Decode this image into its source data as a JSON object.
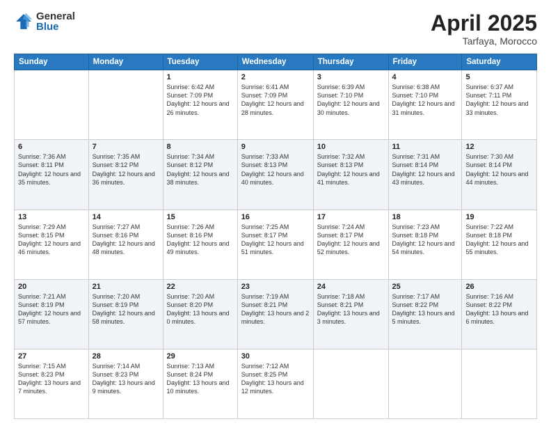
{
  "header": {
    "logo_general": "General",
    "logo_blue": "Blue",
    "title": "April 2025",
    "location": "Tarfaya, Morocco"
  },
  "days_of_week": [
    "Sunday",
    "Monday",
    "Tuesday",
    "Wednesday",
    "Thursday",
    "Friday",
    "Saturday"
  ],
  "weeks": [
    [
      {
        "day": "",
        "info": ""
      },
      {
        "day": "",
        "info": ""
      },
      {
        "day": "1",
        "info": "Sunrise: 6:42 AM\nSunset: 7:09 PM\nDaylight: 12 hours and 26 minutes."
      },
      {
        "day": "2",
        "info": "Sunrise: 6:41 AM\nSunset: 7:09 PM\nDaylight: 12 hours and 28 minutes."
      },
      {
        "day": "3",
        "info": "Sunrise: 6:39 AM\nSunset: 7:10 PM\nDaylight: 12 hours and 30 minutes."
      },
      {
        "day": "4",
        "info": "Sunrise: 6:38 AM\nSunset: 7:10 PM\nDaylight: 12 hours and 31 minutes."
      },
      {
        "day": "5",
        "info": "Sunrise: 6:37 AM\nSunset: 7:11 PM\nDaylight: 12 hours and 33 minutes."
      }
    ],
    [
      {
        "day": "6",
        "info": "Sunrise: 7:36 AM\nSunset: 8:11 PM\nDaylight: 12 hours and 35 minutes."
      },
      {
        "day": "7",
        "info": "Sunrise: 7:35 AM\nSunset: 8:12 PM\nDaylight: 12 hours and 36 minutes."
      },
      {
        "day": "8",
        "info": "Sunrise: 7:34 AM\nSunset: 8:12 PM\nDaylight: 12 hours and 38 minutes."
      },
      {
        "day": "9",
        "info": "Sunrise: 7:33 AM\nSunset: 8:13 PM\nDaylight: 12 hours and 40 minutes."
      },
      {
        "day": "10",
        "info": "Sunrise: 7:32 AM\nSunset: 8:13 PM\nDaylight: 12 hours and 41 minutes."
      },
      {
        "day": "11",
        "info": "Sunrise: 7:31 AM\nSunset: 8:14 PM\nDaylight: 12 hours and 43 minutes."
      },
      {
        "day": "12",
        "info": "Sunrise: 7:30 AM\nSunset: 8:14 PM\nDaylight: 12 hours and 44 minutes."
      }
    ],
    [
      {
        "day": "13",
        "info": "Sunrise: 7:29 AM\nSunset: 8:15 PM\nDaylight: 12 hours and 46 minutes."
      },
      {
        "day": "14",
        "info": "Sunrise: 7:27 AM\nSunset: 8:16 PM\nDaylight: 12 hours and 48 minutes."
      },
      {
        "day": "15",
        "info": "Sunrise: 7:26 AM\nSunset: 8:16 PM\nDaylight: 12 hours and 49 minutes."
      },
      {
        "day": "16",
        "info": "Sunrise: 7:25 AM\nSunset: 8:17 PM\nDaylight: 12 hours and 51 minutes."
      },
      {
        "day": "17",
        "info": "Sunrise: 7:24 AM\nSunset: 8:17 PM\nDaylight: 12 hours and 52 minutes."
      },
      {
        "day": "18",
        "info": "Sunrise: 7:23 AM\nSunset: 8:18 PM\nDaylight: 12 hours and 54 minutes."
      },
      {
        "day": "19",
        "info": "Sunrise: 7:22 AM\nSunset: 8:18 PM\nDaylight: 12 hours and 55 minutes."
      }
    ],
    [
      {
        "day": "20",
        "info": "Sunrise: 7:21 AM\nSunset: 8:19 PM\nDaylight: 12 hours and 57 minutes."
      },
      {
        "day": "21",
        "info": "Sunrise: 7:20 AM\nSunset: 8:19 PM\nDaylight: 12 hours and 58 minutes."
      },
      {
        "day": "22",
        "info": "Sunrise: 7:20 AM\nSunset: 8:20 PM\nDaylight: 13 hours and 0 minutes."
      },
      {
        "day": "23",
        "info": "Sunrise: 7:19 AM\nSunset: 8:21 PM\nDaylight: 13 hours and 2 minutes."
      },
      {
        "day": "24",
        "info": "Sunrise: 7:18 AM\nSunset: 8:21 PM\nDaylight: 13 hours and 3 minutes."
      },
      {
        "day": "25",
        "info": "Sunrise: 7:17 AM\nSunset: 8:22 PM\nDaylight: 13 hours and 5 minutes."
      },
      {
        "day": "26",
        "info": "Sunrise: 7:16 AM\nSunset: 8:22 PM\nDaylight: 13 hours and 6 minutes."
      }
    ],
    [
      {
        "day": "27",
        "info": "Sunrise: 7:15 AM\nSunset: 8:23 PM\nDaylight: 13 hours and 7 minutes."
      },
      {
        "day": "28",
        "info": "Sunrise: 7:14 AM\nSunset: 8:23 PM\nDaylight: 13 hours and 9 minutes."
      },
      {
        "day": "29",
        "info": "Sunrise: 7:13 AM\nSunset: 8:24 PM\nDaylight: 13 hours and 10 minutes."
      },
      {
        "day": "30",
        "info": "Sunrise: 7:12 AM\nSunset: 8:25 PM\nDaylight: 13 hours and 12 minutes."
      },
      {
        "day": "",
        "info": ""
      },
      {
        "day": "",
        "info": ""
      },
      {
        "day": "",
        "info": ""
      }
    ]
  ]
}
